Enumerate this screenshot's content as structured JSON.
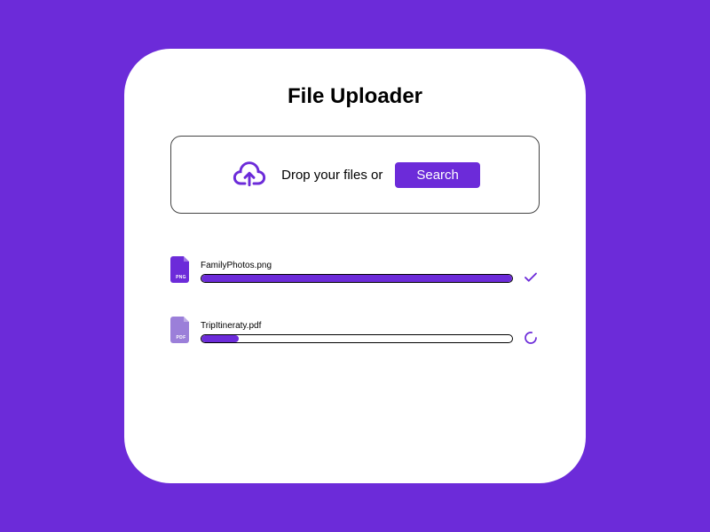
{
  "title": "File Uploader",
  "dropzone": {
    "text": "Drop your files or",
    "button": "Search"
  },
  "files": [
    {
      "name": "FamilyPhotos.png",
      "ext": "PNG",
      "progress": 100,
      "status": "done",
      "iconColor": "#6c2bd9"
    },
    {
      "name": "TripItineraty.pdf",
      "ext": "PDF",
      "progress": 12,
      "status": "loading",
      "iconColor": "#9b7fd9"
    }
  ],
  "colors": {
    "accent": "#6c2bd9"
  }
}
